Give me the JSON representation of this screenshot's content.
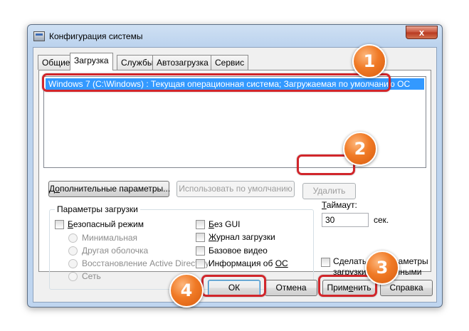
{
  "window": {
    "title": "Конфигурация системы",
    "close_symbol": "x"
  },
  "tabs": [
    {
      "label": "Общие",
      "selected": false
    },
    {
      "label": "Загрузка",
      "selected": true
    },
    {
      "label": "Службы",
      "selected": false
    },
    {
      "label": "Автозагрузка",
      "selected": false
    },
    {
      "label": "Сервис",
      "selected": false
    }
  ],
  "boot_entries": [
    "Windows 7 (C:\\Windows) : Текущая операционная система; Загружаемая по умолчанию ОС"
  ],
  "buttons": {
    "advanced_pre": "Д",
    "advanced_ul": "о",
    "advanced_post": "полнительные параметры...",
    "set_default": "Использовать по умолчанию",
    "delete": "Удалить",
    "ok": "ОК",
    "cancel": "Отмена",
    "apply_pre": "Прим",
    "apply_ul": "е",
    "apply_post": "нить",
    "help": "Справка"
  },
  "boot_options": {
    "title": "Параметры загрузки",
    "safe_boot_ul": "Б",
    "safe_boot_rest": "езопасный режим",
    "radio_minimal": "Минимальная",
    "radio_alt_shell": "Другая оболочка",
    "radio_ad_repair": "Восстановление Active Directory",
    "radio_network": "Сеть",
    "no_gui_ul": "Б",
    "no_gui_rest": "ез GUI",
    "boot_log_ul": "Ж",
    "boot_log_rest": "урнал загрузки",
    "base_video": "Базовое видео",
    "os_info_pre": "Информация  об ",
    "os_info_ul": "ОС"
  },
  "timeout": {
    "label_pre": "",
    "label_ul": "Т",
    "label_post": "аймаут:",
    "value": "30",
    "unit": "сек."
  },
  "permanent": {
    "label": "Сделать эти параметры загрузки постоянными"
  },
  "markers": [
    "1",
    "2",
    "3",
    "4"
  ],
  "colors": {
    "highlight_ring": "#d1262b",
    "marker_fill": "#f07a26",
    "selection": "#3399ff"
  }
}
